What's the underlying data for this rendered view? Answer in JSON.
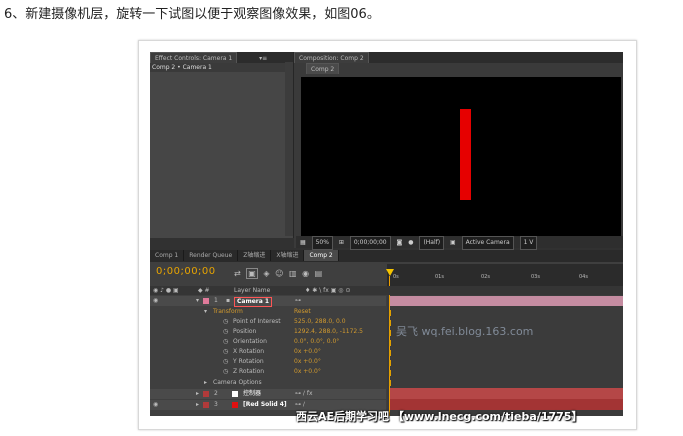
{
  "caption": "6、新建摄像机层，旋转一下试图以便于观察图像效果，如图06。",
  "effect_controls": {
    "tab": "Effect Controls: Camera 1",
    "breadcrumb": "Comp 2 • Camera 1"
  },
  "composition": {
    "tab": "Composition: Comp 2",
    "comp_tab": "Comp 2"
  },
  "viewer_toolbar": {
    "zoom": "50%",
    "timecode": "0;00;00;00",
    "resolution": "(Half)",
    "camera": "Active Camera",
    "view": "1 V"
  },
  "timeline_tabs": [
    "Comp 1",
    "Render Queue",
    "Z轴缩进",
    "X轴缩进",
    "Comp 2"
  ],
  "timeline": {
    "timecode": "0;00;00;00",
    "ruler_ticks": [
      "0s",
      "01s",
      "02s",
      "03s",
      "04s"
    ],
    "header_layer_name": "Layer Name",
    "header_switches": "♦ ✱ \\ fx ▣ ◎ ⊙"
  },
  "layers": [
    {
      "num": "1",
      "name": "Camera 1",
      "color": "#e07a9a"
    },
    {
      "num": "2",
      "name": "控制器",
      "color": "#ffffff"
    },
    {
      "num": "3",
      "name": "[Red Solid 4]",
      "color": "#e01010"
    }
  ],
  "properties": [
    {
      "name": "Transform",
      "value": "Reset"
    },
    {
      "name": "Point of Interest",
      "value": "525.0, 288.0, 0.0"
    },
    {
      "name": "Position",
      "value": "1292.4, 288.0, -1172.5"
    },
    {
      "name": "Orientation",
      "value": "0.0°, 0.0°, 0.0°"
    },
    {
      "name": "X Rotation",
      "value": "0x +0.0°"
    },
    {
      "name": "Y Rotation",
      "value": "0x +0.0°"
    },
    {
      "name": "Z Rotation",
      "value": "0x +0.0°"
    },
    {
      "name": "Camera Options",
      "value": ""
    }
  ],
  "watermarks": {
    "blog": "吴飞 wq.fei.blog.163.com",
    "site": "西云AE后期学习吧 【www.lnecg.com/tieba/1775】"
  }
}
